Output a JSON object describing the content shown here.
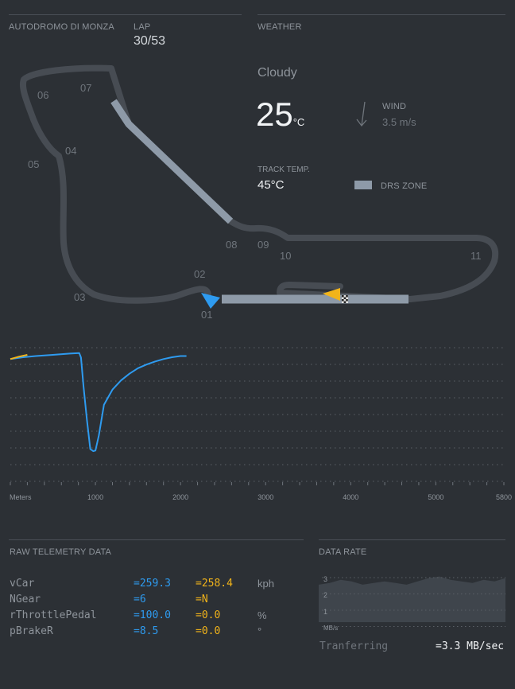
{
  "circuit": {
    "name": "AUTODROMO DI MONZA"
  },
  "lap": {
    "label": "LAP",
    "value": "30/53"
  },
  "weather": {
    "title": "WEATHER",
    "condition": "Cloudy",
    "temp_value": "25",
    "temp_unit": "°C",
    "wind_label": "WIND",
    "wind_value": "3.5 m/s",
    "track_temp_label": "TRACK TEMP.",
    "track_temp_value": "45°C",
    "drs_label": "DRS ZONE"
  },
  "turns": [
    "01",
    "02",
    "03",
    "04",
    "05",
    "06",
    "07",
    "08",
    "09",
    "10",
    "11"
  ],
  "chart_data": {
    "type": "line",
    "xlabel": "Meters",
    "xlim": [
      0,
      5800
    ],
    "ylim": [
      0,
      360
    ],
    "x_ticks": [
      1000,
      2000,
      3000,
      4000,
      5000,
      5800
    ],
    "grid": true,
    "series": [
      {
        "color": "#2e9bf0",
        "x": [
          0,
          150,
          300,
          500,
          700,
          810,
          830,
          860,
          900,
          940,
          975,
          1000,
          1040,
          1100,
          1200,
          1300,
          1400,
          1500,
          1600,
          1700,
          1800,
          1900,
          2000,
          2070
        ],
        "y": [
          320,
          326,
          330,
          334,
          338,
          340,
          325,
          230,
          120,
          25,
          18,
          20,
          70,
          170,
          220,
          250,
          272,
          290,
          302,
          312,
          320,
          326,
          330,
          330
        ]
      },
      {
        "color": "#f2b41a",
        "x": [
          0,
          100,
          200
        ],
        "y": [
          320,
          328,
          334
        ]
      }
    ]
  },
  "telemetry": {
    "title": "RAW TELEMETRY DATA",
    "rows": [
      {
        "name": "vCar",
        "v1": "=259.3",
        "v2": "=258.4",
        "unit": "kph"
      },
      {
        "name": "NGear",
        "v1": "=6",
        "v2": "=N",
        "unit": ""
      },
      {
        "name": "rThrottlePedal",
        "v1": "=100.0",
        "v2": "=0.0",
        "unit": "%"
      },
      {
        "name": "pBrakeR",
        "v1": "=8.5",
        "v2": "=0.0",
        "unit": "°"
      }
    ]
  },
  "data_rate": {
    "title": "DATA RATE",
    "y_ticks": [
      "3",
      "2",
      "1"
    ],
    "unit": "MB/s",
    "values": [
      2.3,
      2.4,
      2.6,
      2.5,
      2.3,
      2.4,
      2.5,
      2.4,
      2.3,
      2.5,
      2.7,
      2.8,
      2.6,
      2.5,
      2.4,
      2.6,
      2.5,
      2.7
    ],
    "status_label": "Tranferring",
    "status_value": "=3.3 MB/sec"
  }
}
